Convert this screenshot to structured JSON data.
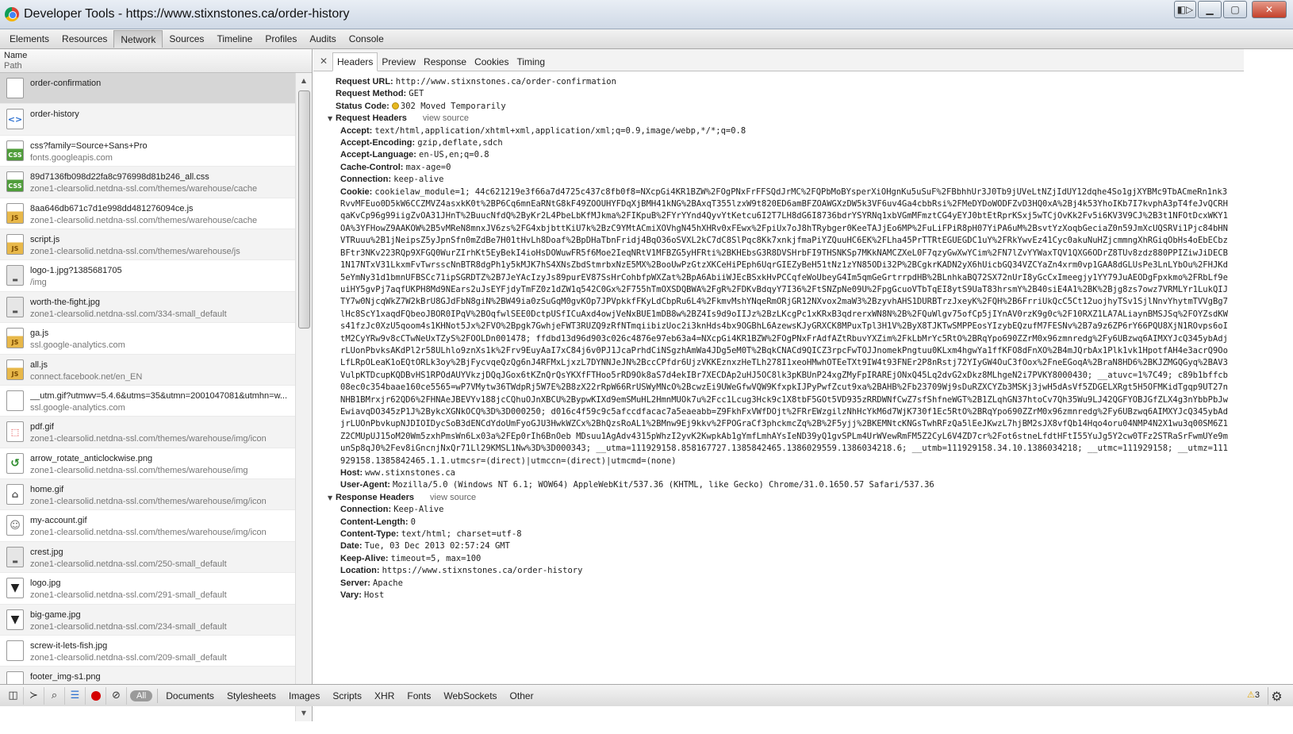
{
  "window": {
    "title": "Developer Tools - https://www.stixnstones.ca/order-history",
    "buttons": [
      "dock",
      "minimize",
      "maximize",
      "close"
    ]
  },
  "panels": [
    "Elements",
    "Resources",
    "Network",
    "Sources",
    "Timeline",
    "Profiles",
    "Audits",
    "Console"
  ],
  "active_panel": "Network",
  "list_header": {
    "name": "Name",
    "path": "Path"
  },
  "requests": [
    {
      "name": "order-confirmation",
      "path": "",
      "icon": "blank-doc-icon",
      "selected": true
    },
    {
      "name": "order-history",
      "path": "",
      "icon": "html-doc-icon"
    },
    {
      "name": "css?family=Source+Sans+Pro",
      "path": "fonts.googleapis.com",
      "icon": "css-file-icon"
    },
    {
      "name": "89d7136fb098d22fa8c976998d81b246_all.css",
      "path": "zone1-clearsolid.netdna-ssl.com/themes/warehouse/cache",
      "icon": "css-file-icon"
    },
    {
      "name": "8aa646db671c7d1e998dd481276094ce.js",
      "path": "zone1-clearsolid.netdna-ssl.com/themes/warehouse/cache",
      "icon": "js-file-icon"
    },
    {
      "name": "script.js",
      "path": "zone1-clearsolid.netdna-ssl.com/themes/warehouse/js",
      "icon": "js-file-icon"
    },
    {
      "name": "logo-1.jpg?1385681705",
      "path": "/img",
      "icon": "image-icon"
    },
    {
      "name": "worth-the-fight.jpg",
      "path": "zone1-clearsolid.netdna-ssl.com/334-small_default",
      "icon": "image-icon"
    },
    {
      "name": "ga.js",
      "path": "ssl.google-analytics.com",
      "icon": "js-file-icon"
    },
    {
      "name": "all.js",
      "path": "connect.facebook.net/en_EN",
      "icon": "js-file-icon"
    },
    {
      "name": "__utm.gif?utmwv=5.4.6&utms=35&utmn=2001047081&utmhn=w...",
      "path": "ssl.google-analytics.com",
      "icon": "blank-doc-icon"
    },
    {
      "name": "pdf.gif",
      "path": "zone1-clearsolid.netdna-ssl.com/themes/warehouse/img/icon",
      "icon": "pdf-icon"
    },
    {
      "name": "arrow_rotate_anticlockwise.png",
      "path": "zone1-clearsolid.netdna-ssl.com/themes/warehouse/img",
      "icon": "arrow-rotate-icon"
    },
    {
      "name": "home.gif",
      "path": "zone1-clearsolid.netdna-ssl.com/themes/warehouse/img/icon",
      "icon": "home-icon"
    },
    {
      "name": "my-account.gif",
      "path": "zone1-clearsolid.netdna-ssl.com/themes/warehouse/img/icon",
      "icon": "person-icon"
    },
    {
      "name": "crest.jpg",
      "path": "zone1-clearsolid.netdna-ssl.com/250-small_default",
      "icon": "image-icon"
    },
    {
      "name": "logo.jpg",
      "path": "zone1-clearsolid.netdna-ssl.com/291-small_default",
      "icon": "shirt-icon"
    },
    {
      "name": "big-game.jpg",
      "path": "zone1-clearsolid.netdna-ssl.com/234-small_default",
      "icon": "shirt-icon"
    },
    {
      "name": "screw-it-lets-fish.jpg",
      "path": "zone1-clearsolid.netdna-ssl.com/209-small_default",
      "icon": "blank-doc-icon"
    },
    {
      "name": "footer_img-s1.png",
      "path": "",
      "icon": "blank-doc-icon"
    }
  ],
  "detail_tabs": [
    "Headers",
    "Preview",
    "Response",
    "Cookies",
    "Timing"
  ],
  "active_detail_tab": "Headers",
  "general": {
    "url_label": "Request URL:",
    "url": "http://www.stixnstones.ca/order-confirmation",
    "method_label": "Request Method:",
    "method": "GET",
    "status_label": "Status Code:",
    "status": "302 Moved Temporarily"
  },
  "request_headers": {
    "title": "Request Headers",
    "view_source": "view source",
    "items": [
      {
        "k": "Accept:",
        "v": "text/html,application/xhtml+xml,application/xml;q=0.9,image/webp,*/*;q=0.8"
      },
      {
        "k": "Accept-Encoding:",
        "v": "gzip,deflate,sdch"
      },
      {
        "k": "Accept-Language:",
        "v": "en-US,en;q=0.8"
      },
      {
        "k": "Cache-Control:",
        "v": "max-age=0"
      },
      {
        "k": "Connection:",
        "v": "keep-alive"
      }
    ],
    "cookie_label": "Cookie:",
    "cookie": "cookielaw_module=1; 44c621219e3f66a7d4725c437c8fb0f8=NXcpGi4KR1BZW%2FOgPNxFrFFSQdJrMC%2FQPbMoBYsperXiOHgnKu5uSuF%2FBbhhUr3J0Tb9jUVeLtNZjIdUY12dqhe4So1gjXYBMc9TbACmeRn1nk3RvvMFEuo0D5kW6CCZMVZ4asxkK0t%2BP6Cq6mnEaRNtG8kF49ZOOUHYFDqXjBMH41kNG%2BAxqT355lzxW9t820ED6amBFZOAWGXzDW5k3VF6uv4Ga4cbbRsi%2FMeDYDoWODFZvD3HQ0xA%2Bj4k53YhoIKb7I7kvphA3pT4feJvQCRHqaKvCp96g99iigZvOA31JHnT%2BuucNfdQ%2ByKr2L4PbeLbKfMJkma%2FIKpuB%2FYrYYnd4QyvYtKetcu6I2T7LH8dG6I8736bdrYSYRNq1xbVGmMFmztCG4yEYJ0btEtRprKSxj5wTCjOvKk2Fv5i6KV3V9CJ%2B3t1NFOtDcxWKY1OA%3YFHowZ9AAKOW%2B5vMReN8mnxJV6zs%2FG4xbjbttKiU7k%2BzC9YMtACmiXOVhgN45hXHRv0xFEwx%2FpiUx7oJ8hTRybger0KeeTAJjEo6MP%2FuLiFPiR8pH07YiPA6uM%2BsvtYzXoqbGeciaZ0n59JmXcUQSRVi1Pjc84bHNVTRuuu%2B1jNeipsZ5yJpnSfn0mZdBe7H01tHvLh8Doaf%2BpDHaTbnFridj4BqO36oSVXL2kC7dC8SlPqc8Kk7xnkjfmaPiYZQuuHC6EK%2FLha45PrTTRtEGUEGDC1uY%2FRkYwvEz41Cyc0akuNuHZjcmmngXhRGiqObHs4oEbECbzBFtr3NKv223RQp9XFGQ0WurZIrhKt5EyBekI4ioHsDOWuwFR5f6Moe2IeqNRtV1MFBZG5yHFRti%2BKHEbsG3R8DVSHrbFI9THSNKSp7MKkNAMCZXeL0F7qzyGwXwYCim%2FN7lZvYYWaxTQV1QXG6ODrZ8TUv8zdz880PPIZiwJiDECB1N17NTxV31LkxmFvTwrsscNnBTR8dgPh1y5kMJK7hS4XNsZbdStmrbxNzE5MX%2BooUwPzGtzXKCeHiPEph6UqrGIEZyBeH51tNz1zYN85ODi32P%2BCgkrKADN2yX6hUicbGQ34VZCYaZn4xrm0vp1GAA8dGLUsPe3LnLYbOu%2FHJKd5eYmNy31d1bmnUFBSCc71ipSGRDTZ%2B7JeYAcIzyJs89purEV87SsHrCohbfpWXZat%2BpA6AbiiWJEcBSxkHvPCCqfeWoUbeyG4Im5qmGeGrtrrpdHB%2BLnhkaBQ72SX72nUrI8yGcCxImeegjy1YY79JuAEODgFpxkmo%2FRbLf9euiHY5gvPj7aqfUKPH8Md9NEars2uJsEYFjdyTmFZ0z1dZW1q542C0Gx%2F755hTmOXSDQBWA%2FgR%2FDKvBdqyY7I36%2FtSNZpNe09U%2FpgGcuoVTbTqEI8ytS9UaT83hrsmY%2B40siE4A1%2BK%2Bjg8zs7owz7VRMLYr1LukQIJTY7w0NjcqWkZ7W2kBrU8GJdFbN8giN%2BW49ia0zSuGqM0gvKOp7JPVpkkfFKyLdCbpRu6L4%2FkmvMshYNqeRmORjGR12NXvox2maW3%2BzyvhAHS1DURBTrzJxeyK%2FQH%2B6FrriUkQcC5Ct12uojhyTSv1SjlNnvYhytmTVVgBg7lHc8ScY1xaqdFQbeoJBOR0IPqV%2BOqfwlSEE0DctpUSfICuAxd4owjVeNxBUE1mDB8w%2BZ4Is9d9oIIJz%2BzLKcgPc1xKRxB3qdrerxWN8N%2B%2FQuWlgv75ofCp5jIYnAV0rzK9g0c%2F10RXZ1LA7ALiaynBMSJSq%2FOYZsdKWs41fzJc0XzU5qoom4s1KHNot5Jx%2FVO%2Bpgk7GwhjeFWT3RUZQ9zRfNTmqiibizUoc2i3knHds4bx9OGBhL6AzewsKJyGRXCK8MPuxTpl3H1V%2ByX8TJKTwSMPPEosYIzybEQzufM7FESNv%2B7a9z6ZP6rY66PQU8XjN1ROvps6oItM2CyYRw9v8cCTwNeUxTZyS%2FOOLDn001478; ffdbd13d96d903c026c4876e97eb63a4=NXcpGi4KR1BZW%2FOgPNxFrAdfAZtRbuvYXZim%2FkLbMrYc5RtO%2BRqYpo690ZZrM0x96zmnredg%2Fy6UBzwq6AIMXYJcQ345ybAdjrLUonPbvksAKdPl2r58ULhlo9znXs1k%2Frv9EuyAaI7xC84j6v0PJ1JcaPrhdCiNSgzhAmWa4JDg5eM0T%2BqkCNACd9QICZ3rpcFwTOJJnomekPngtuu0KLxm4hgwYa1ffKFO8dFnXO%2B4mJQrbAx1Plk1vk1HpotfAH4e3acrQ9OoLfLRpOLeaK1oEQtORLk3oy%2BjFycvqeQzQg6nJ4RFMxLjxzL7DYNNJeJN%2BccCPfdr6UjzVKKEznxzHeTLh278I1xeoHMwhOTEeTXt9IW4t93FNEr2P8nRstj72YIyGW4OuC3fOox%2FneEGoqA%2BraN8HD6%2BKJZMGQGyq%2BAV3VulpKTDcupKQDBvHS1RPOdAUYVkzjDQqJGox6tKZnQrQsYKXfFTHoo5rRD9Ok8aS7d4ekIBr7XECDAp2uHJ5OC8lk3pKBUnP24xgZMyFpIRAREjONxQ45Lq2dvG2xDkz8MLhgeN2i7PVKY8000430; __atuvc=1%7C49; c89b1bffcb08ec0c354baae160ce5565=wP7VMytw36TWdpRj5W7E%2B8zX22rRpW66RrUSWyMNcO%2BcwzEi9UWeGfwVQW9KfxpkIJPyPwfZcut9xa%2BAHB%2Fb23709Wj9sDuRZXCYZb3MSKj3jwH5dAsVf5ZDGELXRgt5H5OFMKidTgqp9UT27nNHB1BMrxjr62QD6%2FHNAeJBEVYv188jcCQhuOJnXBCU%2BypwKIXd9emSMuHL2HmnMUOk7u%2Fcc1Lcug3Hck9c1X8tbF5GOt5VD935zRRDWNfCwZ7sfShfneWGT%2B1ZLqhGN37htoCv7Qh35Wu9LJ42QGFYOBJGfZLX4g3nYbbPbJwEwiavqDO345zP1J%2BykcXGNkOCQ%3D%3D000250; d016c4f59c9c5afccdfacac7a5eaeabb=Z9FkhFxVWfDOjt%2FRrEWzgilzNhHcYkM6d7WjK730f1Ec5RtO%2BRqYpo690ZZrM0x96zmnredg%2Fy6UBzwq6AIMXYJcQ345ybAdjrLUOnPbvkupNJDIOIDycSoB3dENCdYdoUmFyoGJU3HwkWZCx%2BhQzsRoAL1%2BMnw9Ej9kkv%2FPOGraCf3phckmcZq%2B%2F5yjj%2BKEMNtcKNGsTwhRFzQa5lEeJKwzL7hjBM2sJX8vfQb14Hqo4oru04NMP4N2X1wu3q00SM6Z1Z2CMUpUJ15oM20Wm5zxhPmsWn6Lx03a%2FEp0rIh6BnOeb MDsuu1AgAdv4315pWhzI2yvK2KwpkAb1gYmfLmhAYsIeND39yQ1gvSPLm4UrWVewRmFM5Z2CyL6V4ZD7cr%2Fot6stneLfdtHFtI55YuJg5Y2cw0TFz2STRaSrFwmUYe9munSp8qJ0%2Fev8iGncnjNxQr71Ll29KMSL1Nw%3D%3D000343; __utma=111929158.858167727.1385842465.1386029559.1386034218.6; __utmb=111929158.34.10.1386034218; __utmc=111929158; __utmz=111929158.1385842465.1.1.utmcsr=(direct)|utmccn=(direct)|utmcmd=(none)",
    "host_label": "Host:",
    "host": "www.stixnstones.ca",
    "ua_label": "User-Agent:",
    "ua": "Mozilla/5.0 (Windows NT 6.1; WOW64) AppleWebKit/537.36 (KHTML, like Gecko) Chrome/31.0.1650.57 Safari/537.36"
  },
  "response_headers": {
    "title": "Response Headers",
    "view_source": "view source",
    "items": [
      {
        "k": "Connection:",
        "v": "Keep-Alive"
      },
      {
        "k": "Content-Length:",
        "v": "0"
      },
      {
        "k": "Content-Type:",
        "v": "text/html; charset=utf-8"
      },
      {
        "k": "Date:",
        "v": "Tue, 03 Dec 2013 02:57:24 GMT"
      },
      {
        "k": "Keep-Alive:",
        "v": "timeout=5, max=100"
      },
      {
        "k": "Location:",
        "v": "https://www.stixnstones.ca/order-history"
      },
      {
        "k": "Server:",
        "v": "Apache"
      },
      {
        "k": "Vary:",
        "v": "Host"
      }
    ]
  },
  "toolbar": {
    "icons": [
      "dock-icon",
      "console-icon",
      "search-icon",
      "list-view-icon",
      "record-icon",
      "clear-icon"
    ],
    "all_label": "All",
    "filters": [
      "Documents",
      "Stylesheets",
      "Images",
      "Scripts",
      "XHR",
      "Fonts",
      "WebSockets",
      "Other"
    ],
    "warnings": "3"
  }
}
